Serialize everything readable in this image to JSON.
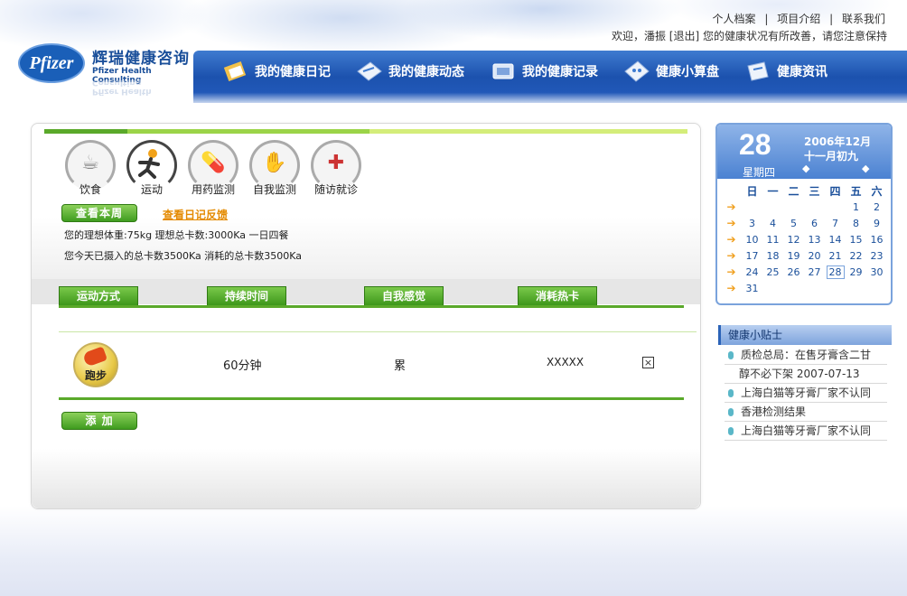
{
  "header": {
    "logo_mark": "Pfizer",
    "logo_cn": "辉瑞健康咨询",
    "logo_en": "Pfizer Health Consulting",
    "toplinks": [
      "个人档案",
      "项目介绍",
      "联系我们"
    ],
    "toplink_sep": "|",
    "welcome_prefix": "欢迎，潘振",
    "logout": "[退出]",
    "welcome_suffix": "您的健康状况有所改善，请您注意保持"
  },
  "nav": [
    {
      "label": "我的健康日记",
      "icon": "diary-icon"
    },
    {
      "label": "我的健康动态",
      "icon": "dynamics-icon"
    },
    {
      "label": "我的健康记录",
      "icon": "records-icon"
    },
    {
      "label": "健康小算盘",
      "icon": "calculator-icon"
    },
    {
      "label": "健康资讯",
      "icon": "news-icon"
    }
  ],
  "categories": [
    {
      "label": "饮食",
      "icon": "food-icon",
      "glyph": "☕"
    },
    {
      "label": "运动",
      "icon": "exercise-icon",
      "glyph": "🏃"
    },
    {
      "label": "用药监测",
      "icon": "medicine-icon",
      "glyph": "💊"
    },
    {
      "label": "自我监测",
      "icon": "self-monitor-icon",
      "glyph": "✋"
    },
    {
      "label": "随访就诊",
      "icon": "medical-kit-icon",
      "glyph": "✚"
    }
  ],
  "actions": {
    "view_week": "查看本周",
    "view_feedback": "查看日记反馈",
    "add": "添  加"
  },
  "info": {
    "line1": "您的理想体重:75kg 理想总卡数:3000Ka 一日四餐",
    "line2": "您今天已摄入的总卡数3500Ka 消耗的总卡数3500Ka"
  },
  "table": {
    "headers": [
      "运动方式",
      "持续时间",
      "自我感觉",
      "消耗热卡"
    ],
    "rows": [
      {
        "type": "跑步",
        "duration": "60分钟",
        "feeling": "累",
        "calories": "XXXXX",
        "delete": "×"
      }
    ]
  },
  "calendar": {
    "day": "28",
    "weekday": "星期四",
    "year_month": "2006年12月",
    "lunar": "十一月初九",
    "prev": "◆",
    "next": "◆",
    "week_headers": [
      "日",
      "一",
      "二",
      "三",
      "四",
      "五",
      "六"
    ],
    "weeks": [
      [
        "",
        "",
        "",
        "",
        "",
        "1",
        "2"
      ],
      [
        "3",
        "4",
        "5",
        "6",
        "7",
        "8",
        "9"
      ],
      [
        "10",
        "11",
        "12",
        "13",
        "14",
        "15",
        "16"
      ],
      [
        "17",
        "18",
        "19",
        "20",
        "21",
        "22",
        "23"
      ],
      [
        "24",
        "25",
        "26",
        "27",
        "28",
        "29",
        "30"
      ],
      [
        "31",
        "",
        "",
        "",
        "",
        "",
        ""
      ]
    ],
    "today": "28",
    "week_arrow": "➔"
  },
  "tips": {
    "title": "健康小贴士",
    "items": [
      {
        "text": "质检总局：在售牙膏含二甘",
        "dot": true
      },
      {
        "text": "醇不必下架  2007-07-13",
        "dot": false
      },
      {
        "text": "上海白猫等牙膏厂家不认同",
        "dot": true
      },
      {
        "text": "香港检测结果",
        "dot": true
      },
      {
        "text": "上海白猫等牙膏厂家不认同",
        "dot": true
      }
    ]
  },
  "colors": {
    "brand_blue": "#1c52ae",
    "accent_green": "#5aa92a",
    "link_orange": "#e48a00"
  }
}
